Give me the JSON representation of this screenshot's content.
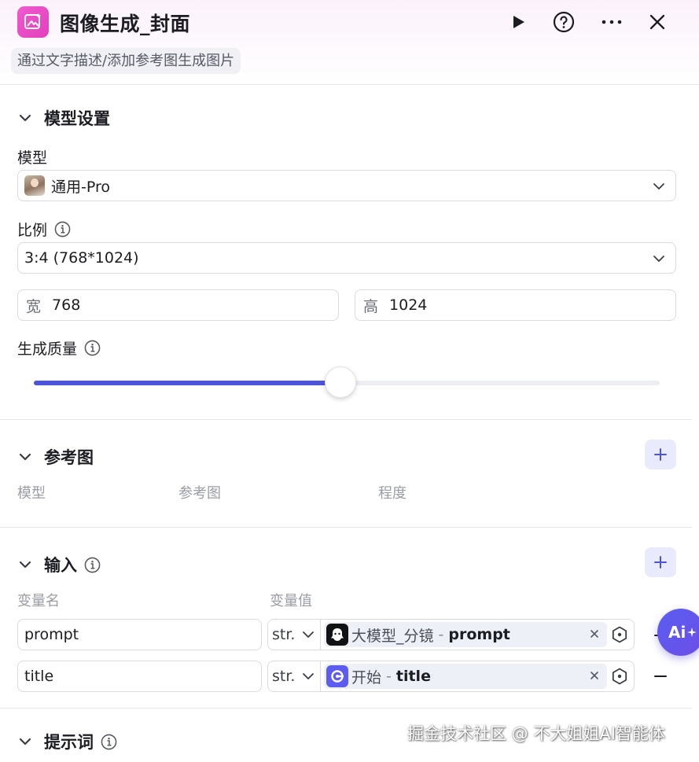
{
  "header": {
    "title": "图像生成_封面",
    "description": "通过文字描述/添加参考图生成图片",
    "accent_color": "#e23fbb"
  },
  "model_settings": {
    "section_title": "模型设置",
    "model_label": "模型",
    "model_value": "通用-Pro",
    "ratio_label": "比例",
    "ratio_value": "3:4 (768*1024)",
    "width_prefix": "宽",
    "width_value": "768",
    "height_prefix": "高",
    "height_value": "1024",
    "quality_label": "生成质量",
    "quality_fraction": 0.49,
    "slider_color": "#4c55d8"
  },
  "reference_image": {
    "section_title": "参考图",
    "columns": [
      "模型",
      "参考图",
      "程度"
    ]
  },
  "input": {
    "section_title": "输入",
    "col_name": "变量名",
    "col_value": "变量值",
    "rows": [
      {
        "name": "prompt",
        "type": "str.",
        "ref_node": "大模型_分镜",
        "sep": "-",
        "ref_var": "prompt",
        "icon": "llm-node-icon"
      },
      {
        "name": "title",
        "type": "str.",
        "ref_node": "开始",
        "sep": "-",
        "ref_var": "title",
        "icon": "start-node-icon"
      }
    ]
  },
  "prompt_section": {
    "section_title": "提示词"
  },
  "ai_button": {
    "label": "Ai"
  },
  "watermark": "掘金技术社区 @ 不大姐姐AI智能体"
}
